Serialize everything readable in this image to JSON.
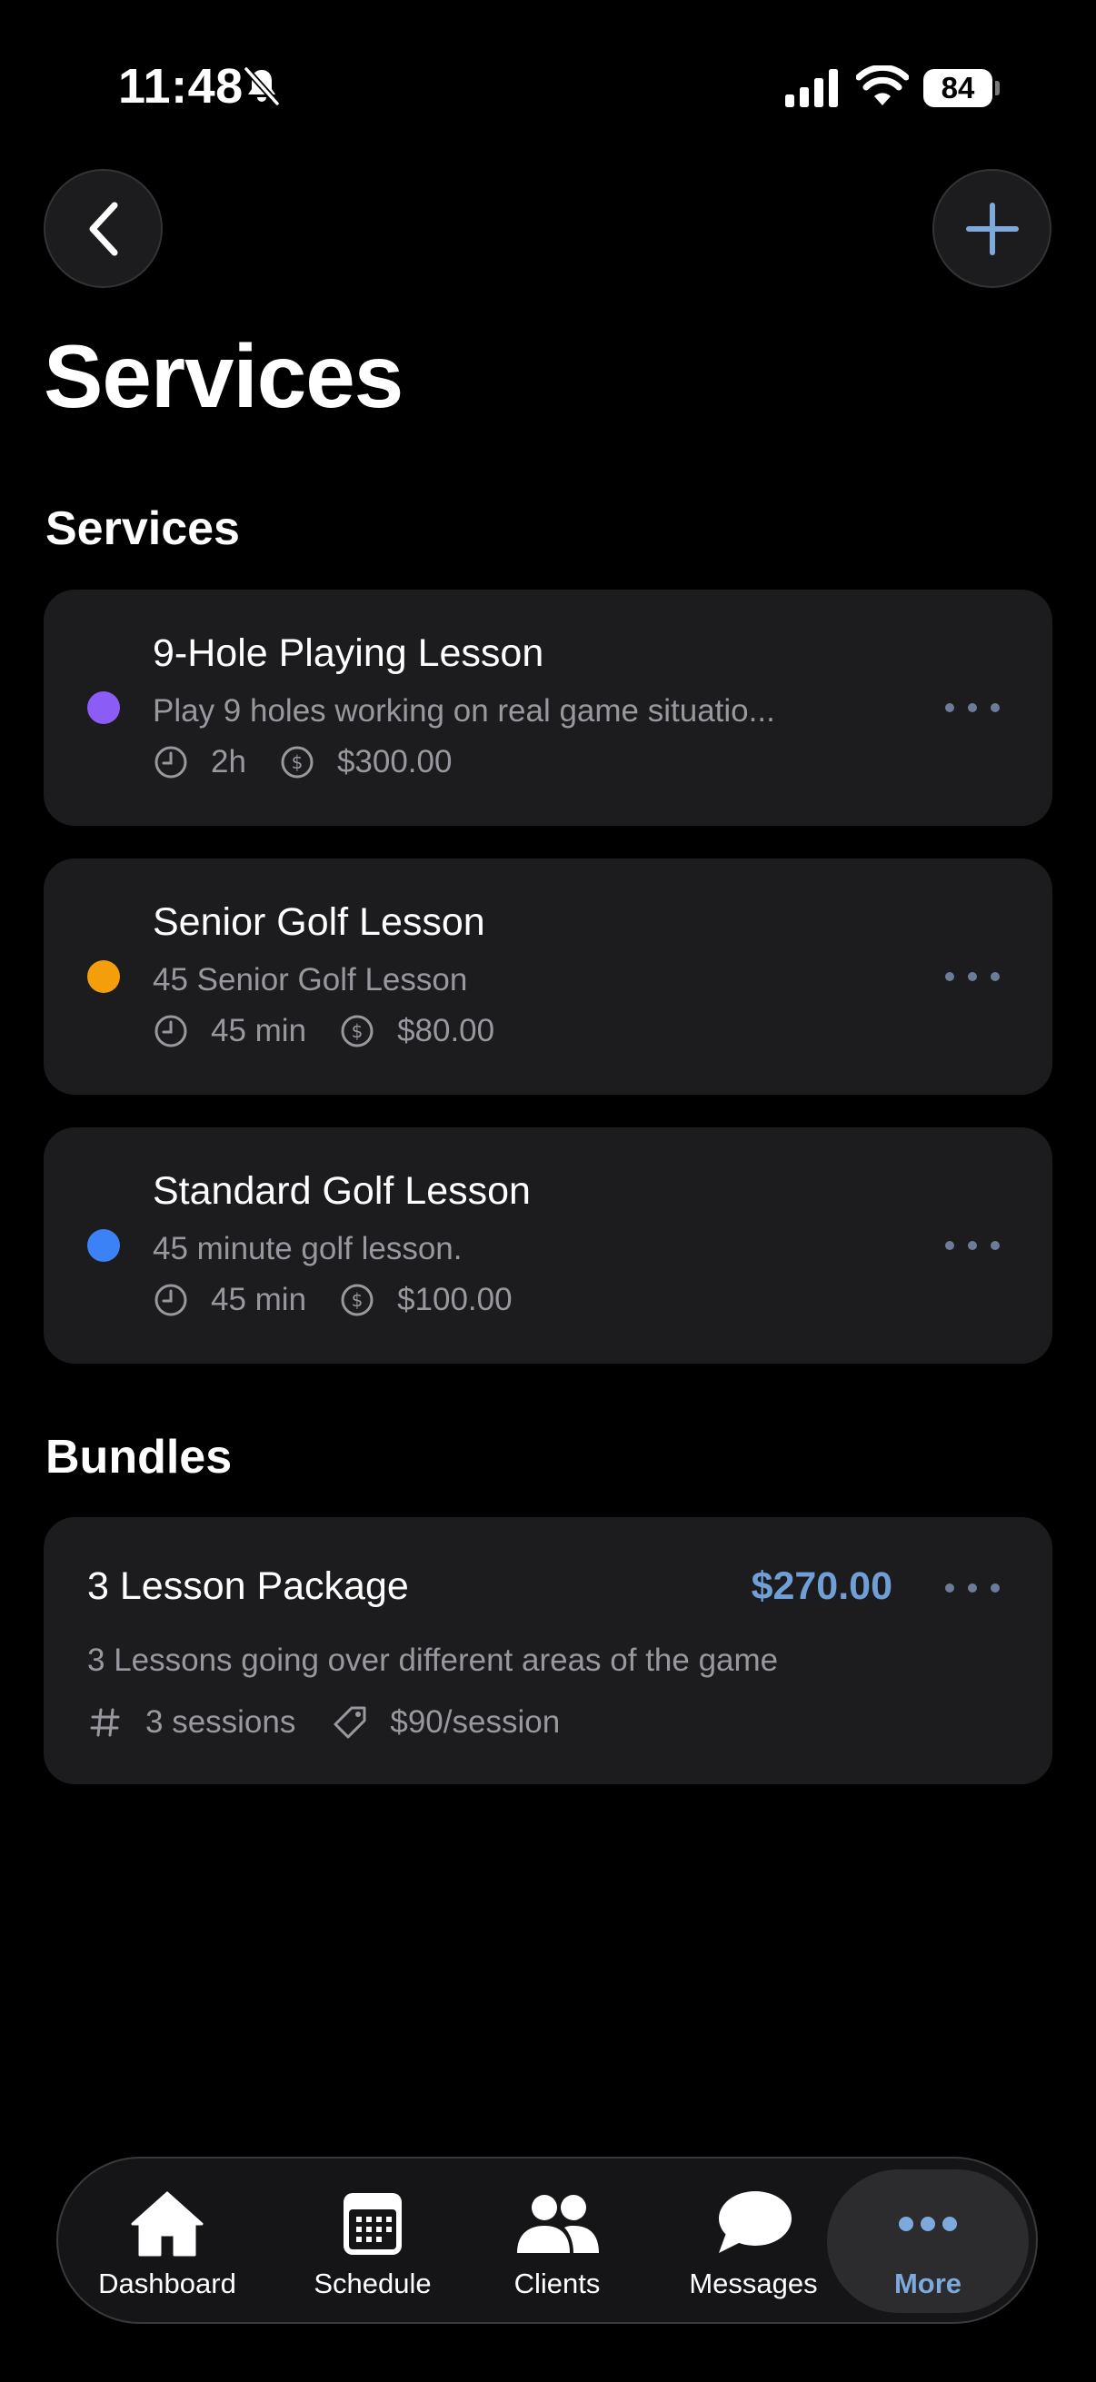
{
  "status_bar": {
    "time": "11:48",
    "battery": "84"
  },
  "page": {
    "title": "Services"
  },
  "sections": {
    "services_title": "Services",
    "bundles_title": "Bundles"
  },
  "services": [
    {
      "name": "9-Hole Playing Lesson",
      "description": "Play 9 holes working on real game situatio...",
      "duration": "2h",
      "price": "$300.00",
      "color": "#8b5cf6"
    },
    {
      "name": "Senior Golf Lesson",
      "description": "45 Senior Golf Lesson",
      "duration": "45 min",
      "price": "$80.00",
      "color": "#f59e0b"
    },
    {
      "name": "Standard Golf Lesson",
      "description": "45 minute golf lesson.",
      "duration": "45 min",
      "price": "$100.00",
      "color": "#3b82f6"
    }
  ],
  "bundles": [
    {
      "name": "3 Lesson Package",
      "price": "$270.00",
      "description": "3 Lessons going over different areas of the game",
      "sessions": "3 sessions",
      "per_session": "$90/session"
    }
  ],
  "tab_bar": {
    "tabs": [
      {
        "label": "Dashboard",
        "icon": "house-icon"
      },
      {
        "label": "Schedule",
        "icon": "calendar-icon"
      },
      {
        "label": "Clients",
        "icon": "people-icon"
      },
      {
        "label": "Messages",
        "icon": "chat-bubble-icon"
      },
      {
        "label": "More",
        "icon": "ellipsis-icon",
        "active": true
      }
    ]
  },
  "colors": {
    "accent": "#6f9fd6",
    "card": "#1c1c1e",
    "secondary_text": "#98989f"
  }
}
